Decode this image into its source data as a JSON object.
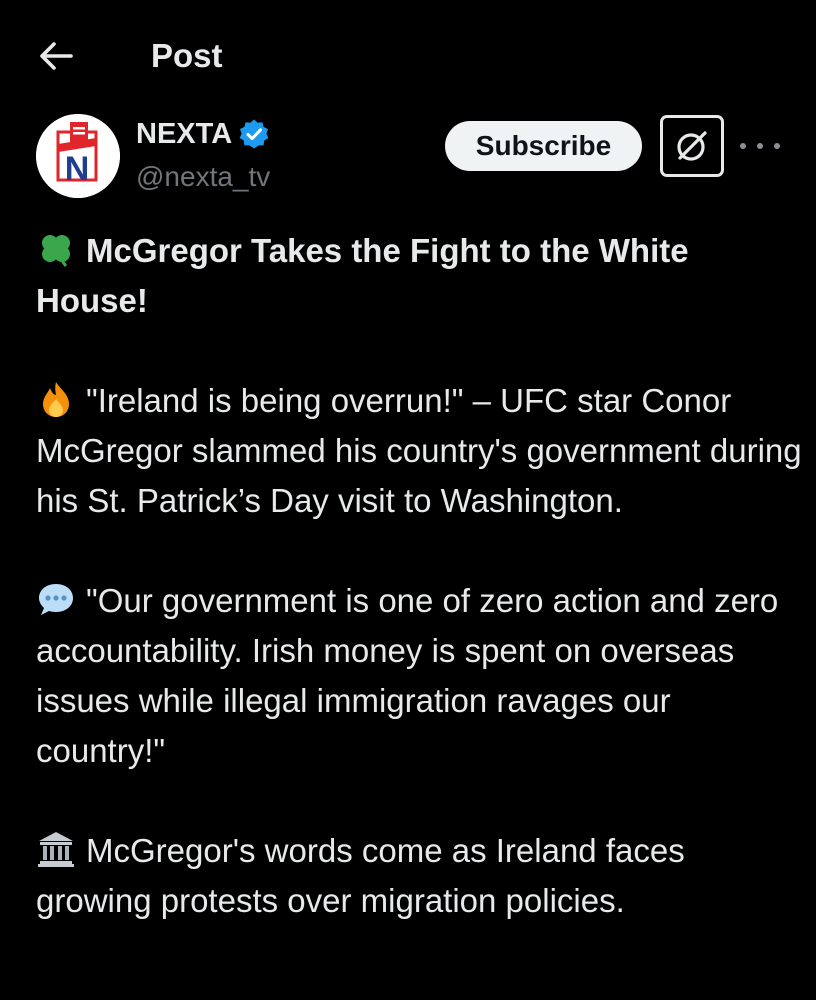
{
  "header": {
    "back_icon": "arrow-left-icon",
    "title": "Post"
  },
  "author": {
    "name": "NEXTA",
    "handle": "@nexta_tv",
    "verified_icon": "verified-badge-icon",
    "avatar_letter": "N"
  },
  "actions": {
    "subscribe_label": "Subscribe",
    "grok_icon": "grok-icon",
    "more_icon": "more-dots-icon"
  },
  "post": {
    "headline_emoji": "shamrock-icon",
    "headline": "McGregor Takes the Fight to the White House!",
    "p1_emoji": "fire-icon",
    "p1": "\"Ireland is being overrun!\" – UFC star Conor McGregor slammed his country's government during his St. Patrick’s Day visit to Washington.",
    "p2_emoji": "speech-bubble-icon",
    "p2": "\"Our government is one of zero action and zero accountability. Irish money is spent on overseas issues while illegal immigration ravages our country!\"",
    "p3_emoji": "classical-building-icon",
    "p3": "McGregor's words come as Ireland faces growing protests over migration policies."
  },
  "colors": {
    "background": "#000000",
    "text_primary": "#e7e9ea",
    "text_secondary": "#71767b",
    "verified_blue": "#1d9bf0",
    "brand_red": "#e0262b",
    "brand_blue": "#1f3e8f"
  }
}
